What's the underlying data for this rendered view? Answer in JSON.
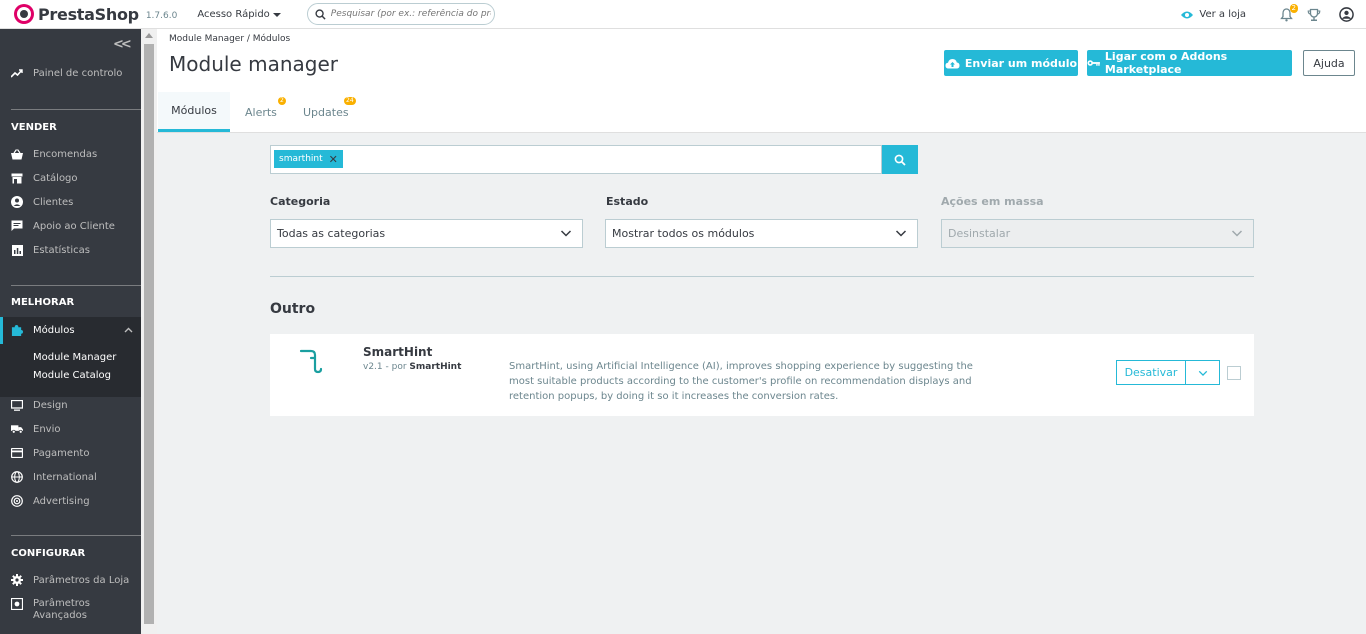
{
  "topbar": {
    "brand": "PrestaShop",
    "version": "1.7.6.0",
    "quick_access": "Acesso Rápido",
    "search_placeholder": "Pesquisar (por ex.: referência do produt",
    "view_shop": "Ver a loja",
    "notif_count": "2"
  },
  "sidebar": {
    "dashboard": "Painel de controlo",
    "section_sell": "VENDER",
    "orders": "Encomendas",
    "catalog": "Catálogo",
    "customers": "Clientes",
    "customer_service": "Apoio ao Cliente",
    "stats": "Estatísticas",
    "section_improve": "MELHORAR",
    "modules": "Módulos",
    "module_manager": "Module Manager",
    "module_catalog": "Module Catalog",
    "design": "Design",
    "shipping": "Envio",
    "payment": "Pagamento",
    "international": "International",
    "advertising": "Advertising",
    "section_configure": "CONFIGURAR",
    "shop_params": "Parâmetros da Loja",
    "advanced_params_1": "Parâmetros",
    "advanced_params_2": "Avançados"
  },
  "header": {
    "breadcrumb": "Module Manager  /   Módulos",
    "title": "Module manager",
    "upload_btn": "Enviar um módulo",
    "addons_btn": "Ligar com o Addons Marketplace",
    "help_btn": "Ajuda",
    "tabs": [
      {
        "label": "Módulos"
      },
      {
        "label": "Alerts",
        "badge": "2"
      },
      {
        "label": "Updates",
        "badge": "24"
      }
    ]
  },
  "filters": {
    "search_tag": "smarthint",
    "category_label": "Categoria",
    "category_value": "Todas as categorias",
    "status_label": "Estado",
    "status_value": "Mostrar todos os módulos",
    "bulk_label": "Ações em massa",
    "bulk_value": "Desinstalar"
  },
  "modules": {
    "category_title": "Outro",
    "item": {
      "name": "SmartHint",
      "version_prefix": "v2.1 - por ",
      "author": "SmartHint",
      "description": "SmartHint, using Artificial Intelligence (AI), improves shopping experience by suggesting the most suitable products according to the customer's profile on recommendation displays and retention popups, by doing it so it increases the conversion rates.",
      "action": "Desativar"
    }
  },
  "colors": {
    "accent": "#25b9d7",
    "sidebar_bg": "#363a41",
    "badge": "#fab000",
    "brand": "#df0067"
  }
}
